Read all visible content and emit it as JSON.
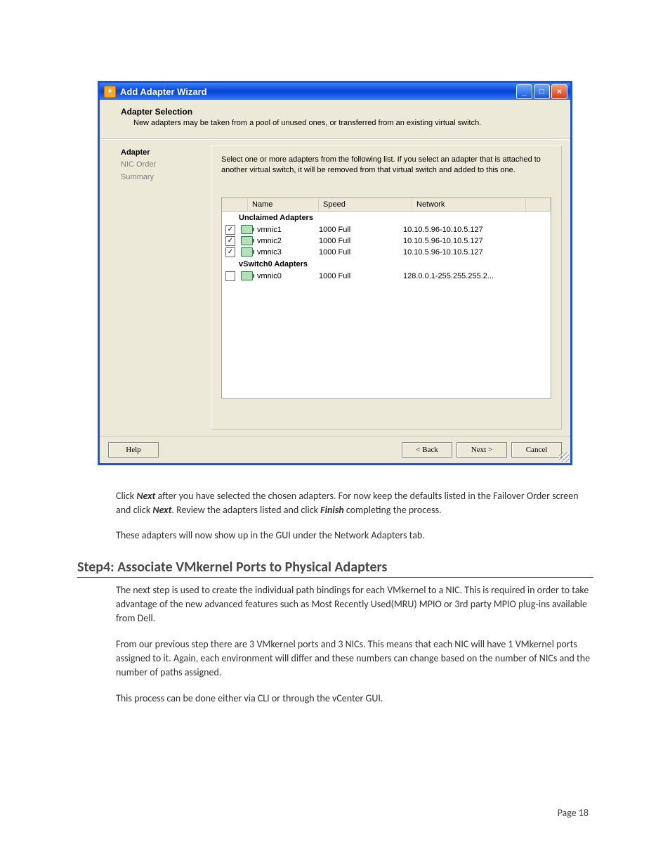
{
  "window": {
    "title": "Add Adapter Wizard",
    "header_title": "Adapter Selection",
    "header_sub": "New adapters may be taken from a pool of unused ones, or transferred from an existing virtual switch."
  },
  "steps": {
    "current": "Adapter",
    "s2": "NIC Order",
    "s3": "Summary"
  },
  "intro": "Select one or more adapters from the following list. If you select an adapter that is attached to another virtual switch, it will be removed from that virtual switch and added to this one.",
  "cols": {
    "name": "Name",
    "speed": "Speed",
    "network": "Network"
  },
  "groups": {
    "g1": "Unclaimed Adapters",
    "g2": "vSwitch0 Adapters"
  },
  "rows": {
    "r1": {
      "chk": "✓",
      "name": "vmnic1",
      "speed": "1000 Full",
      "net": "10.10.5.96-10.10.5.127"
    },
    "r2": {
      "chk": "✓",
      "name": "vmnic2",
      "speed": "1000 Full",
      "net": "10.10.5.96-10.10.5.127"
    },
    "r3": {
      "chk": "✓",
      "name": "vmnic3",
      "speed": "1000 Full",
      "net": "10.10.5.96-10.10.5.127"
    },
    "r4": {
      "chk": "",
      "name": "vmnic0",
      "speed": "1000 Full",
      "net": "128.0.0.1-255.255.255.2..."
    }
  },
  "buttons": {
    "help": "Help",
    "back": "< Back",
    "next": "Next >",
    "cancel": "Cancel"
  },
  "doc": {
    "p1a": "Click ",
    "p1b": "Next",
    "p1c": " after you have selected the chosen adapters. For now keep the defaults listed in the Failover Order screen and click ",
    "p1d": "Next",
    "p1e": ". Review the adapters listed and click ",
    "p1f": "Finish",
    "p1g": " completing the process.",
    "p2": "These adapters will now show up in the GUI under the Network Adapters tab.",
    "step_title": "Step4: Associate VMkernel Ports to Physical Adapters",
    "p3": "The next step is used to create the individual path bindings for each VMkernel to a NIC. This is required in order to take advantage of the new advanced features such as Most Recently Used(MRU) MPIO or 3rd party MPIO plug-ins available from Dell.",
    "p4": "From our previous step there are 3 VMkernel ports and 3 NICs. This means that each NIC will have 1 VMkernel ports assigned to it. Again, each environment will differ and these numbers can change based on the number of NICs and the number of paths assigned.",
    "p5": "This process can be done either via CLI or through the vCenter GUI."
  },
  "page_label": "Page 18"
}
